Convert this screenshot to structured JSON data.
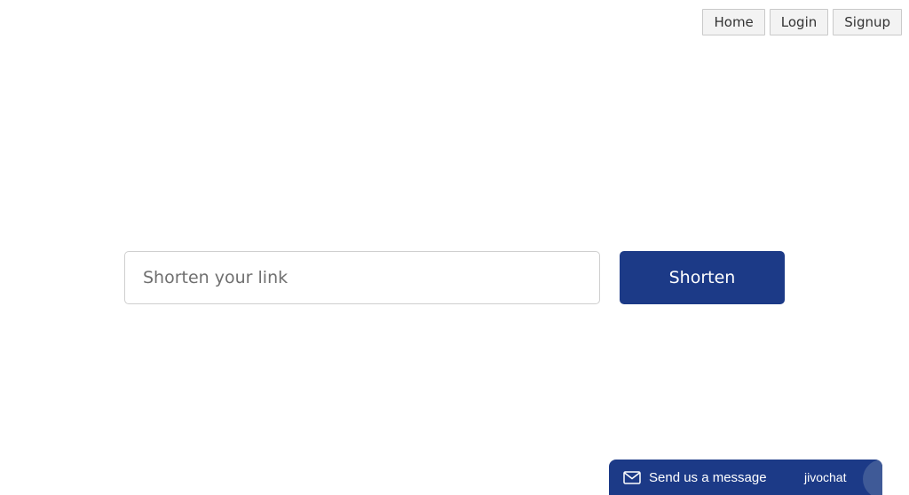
{
  "nav": {
    "home_label": "Home",
    "login_label": "Login",
    "signup_label": "Signup"
  },
  "shorten": {
    "input_placeholder": "Shorten your link",
    "input_value": "",
    "button_label": "Shorten"
  },
  "chat": {
    "icon": "mail-icon",
    "label": "Send us a message",
    "brand": "jivochat"
  },
  "colors": {
    "primary": "#1c3a87",
    "nav_bg": "#f3f3f3",
    "nav_border": "#c9c9c9"
  }
}
